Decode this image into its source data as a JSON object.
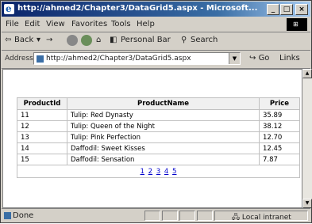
{
  "window": {
    "title": "http://ahmed2/Chapter3/DataGrid5.aspx - Microsoft...",
    "controls": {
      "minimize": "_",
      "maximize": "□",
      "close": "×"
    }
  },
  "menu": [
    "File",
    "Edit",
    "View",
    "Favorites",
    "Tools",
    "Help"
  ],
  "toolbar": {
    "back": "Back",
    "forward": "→",
    "personal_bar": "Personal Bar",
    "search": "Search"
  },
  "address": {
    "label": "Address",
    "url": "http://ahmed2/Chapter3/DataGrid5.aspx",
    "go": "Go",
    "links": "Links"
  },
  "grid": {
    "headers": {
      "id": "ProductId",
      "name": "ProductName",
      "price": "Price"
    },
    "rows": [
      {
        "id": "11",
        "name": "Tulip: Red Dynasty",
        "price": "35.89"
      },
      {
        "id": "12",
        "name": "Tulip: Queen of the Night",
        "price": "38.12"
      },
      {
        "id": "13",
        "name": "Tulip: Pink Perfection",
        "price": "12.70"
      },
      {
        "id": "14",
        "name": "Daffodil: Sweet Kisses",
        "price": "12.45"
      },
      {
        "id": "15",
        "name": "Daffodil: Sensation",
        "price": "7.87"
      }
    ],
    "pages": [
      "1",
      "2",
      "3",
      "4",
      "5"
    ]
  },
  "status": {
    "text": "Done",
    "zone": "Local intranet"
  }
}
